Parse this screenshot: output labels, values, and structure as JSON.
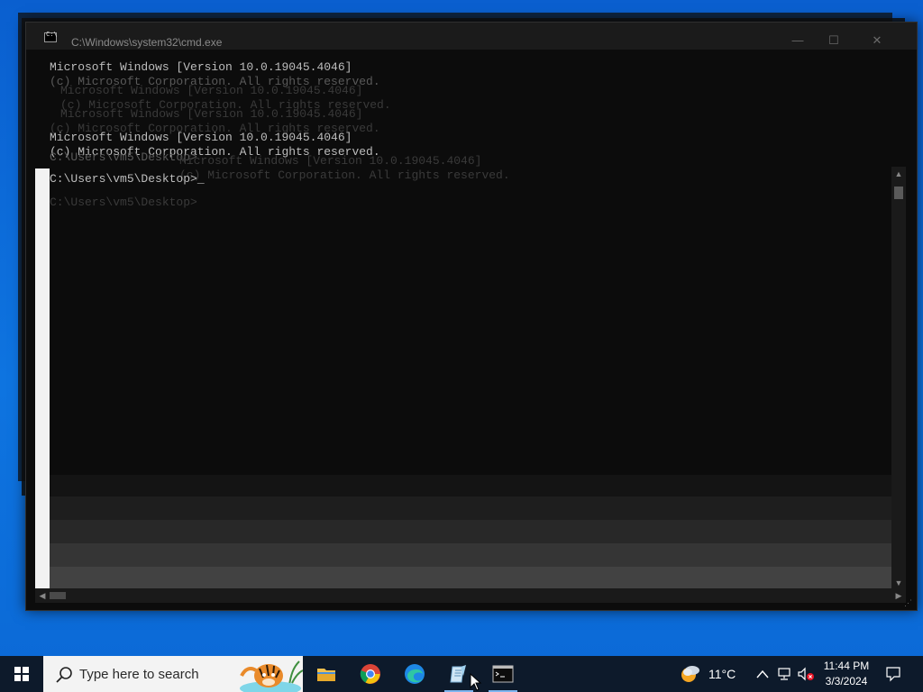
{
  "window": {
    "title": "C:\\Windows\\system32\\cmd.exe",
    "console_lines": [
      "Microsoft Windows [Version 10.0.19045.4046]",
      "(c) Microsoft Corporation. All rights reserved.",
      "C:\\Users\\vm5\\Desktop>"
    ],
    "cursor": "_"
  },
  "window_controls": {
    "minimize": "—",
    "maximize": "☐",
    "close": "✕"
  },
  "taskbar": {
    "search_placeholder": "Type here to search",
    "apps": [
      {
        "name": "File Explorer",
        "icon": "folder-icon"
      },
      {
        "name": "Google Chrome",
        "icon": "chrome-icon"
      },
      {
        "name": "Microsoft Edge",
        "icon": "edge-icon"
      },
      {
        "name": "Notepad",
        "icon": "notepad-icon"
      },
      {
        "name": "Command Prompt",
        "icon": "cmd-icon"
      }
    ],
    "weather": {
      "temp": "11°C",
      "icon": "partly-sunny-icon"
    },
    "clock": {
      "time": "11:44 PM",
      "date": "3/3/2024"
    }
  }
}
